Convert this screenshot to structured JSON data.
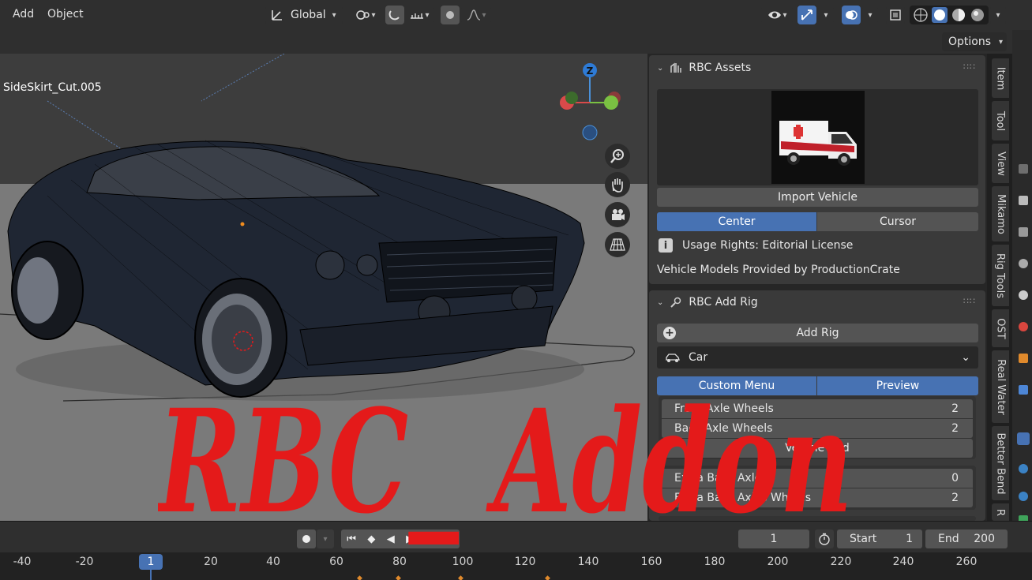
{
  "header": {
    "menus": [
      "Add",
      "Object"
    ],
    "transform_orientation": "Global",
    "options_label": "Options"
  },
  "viewport": {
    "object_label": "SideSkirt_Cut.005",
    "gizmo_axis_label": "Z",
    "nav_icons": [
      "zoom-icon",
      "hand-pan-icon",
      "camera-icon",
      "grid-perspective-icon"
    ]
  },
  "panels": {
    "assets": {
      "title": "RBC Assets",
      "import_label": "Import Vehicle",
      "center_label": "Center",
      "cursor_label": "Cursor",
      "usage_rights": "Usage Rights: Editorial License",
      "credit": "Vehicle Models Provided by ProductionCrate"
    },
    "add_rig": {
      "title": "RBC Add Rig",
      "add_rig_label": "Add Rig",
      "vehicle_type": "Car",
      "custom_menu_label": "Custom Menu",
      "preview_label": "Preview",
      "rows": [
        {
          "label": "Front Axle Wheels",
          "value": "2"
        },
        {
          "label": "Back Axle Wheels",
          "value": "2"
        }
      ],
      "vehicle_bed_label": "Vehicle Bed",
      "extra_rows": [
        {
          "label": "Extra Back Axles",
          "value": "0"
        },
        {
          "label": "Extra Back Axles Wheels",
          "value": "2"
        }
      ]
    }
  },
  "sidebar_tabs": [
    "Item",
    "Tool",
    "View",
    "Mikamo",
    "Rig Tools",
    "OST",
    "Real Water",
    "Better Bend",
    "R"
  ],
  "timeline": {
    "current_frame": "1",
    "start_label": "Start",
    "start_value": "1",
    "end_label": "End",
    "end_value": "200",
    "ruler_ticks": [
      "-40",
      "-20",
      "1",
      "20",
      "40",
      "60",
      "80",
      "100",
      "120",
      "140",
      "160",
      "180",
      "200",
      "220",
      "240",
      "260"
    ]
  },
  "watermark_text": "RBC_ Addon",
  "colors": {
    "accent": "#4772b3",
    "watermark": "#e41a1a",
    "floor": "#7a7a7a",
    "car_body": "#1f2633"
  }
}
